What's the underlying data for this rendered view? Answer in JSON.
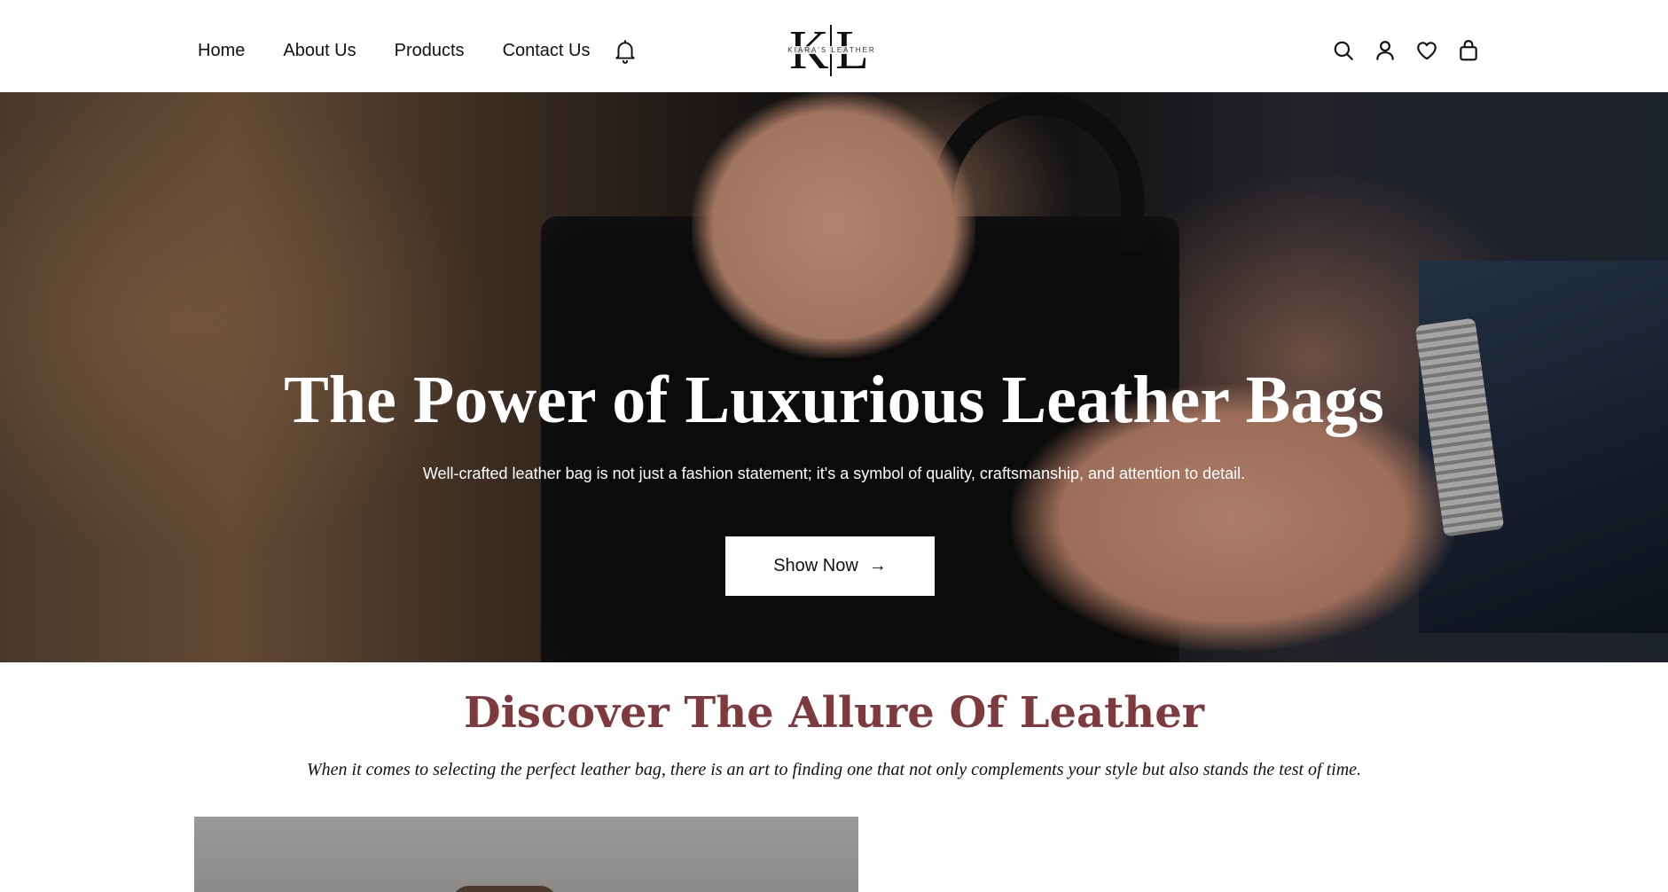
{
  "header": {
    "nav": [
      "Home",
      "About Us",
      "Products",
      "Contact Us"
    ],
    "logo": {
      "mark_left": "K",
      "mark_right": "L",
      "subtitle": "KIARA'S LEATHER"
    }
  },
  "icons": [
    "bell-icon",
    "search-icon",
    "user-icon",
    "heart-icon",
    "bag-icon"
  ],
  "hero": {
    "title": "The Power of Luxurious Leather Bags",
    "subtitle": "Well-crafted leather bag is not just a fashion statement; it's a symbol of quality, craftsmanship, and attention to detail.",
    "button_label": "Show Now",
    "button_arrow": "→"
  },
  "discover": {
    "title": "Discover The Allure Of Leather",
    "subtitle": "When it comes to selecting the perfect leather bag, there is an art to finding one that not only complements your style but also stands the test of time."
  },
  "colors": {
    "accent": "#7e3a3e",
    "text": "#111111",
    "background": "#ffffff"
  }
}
